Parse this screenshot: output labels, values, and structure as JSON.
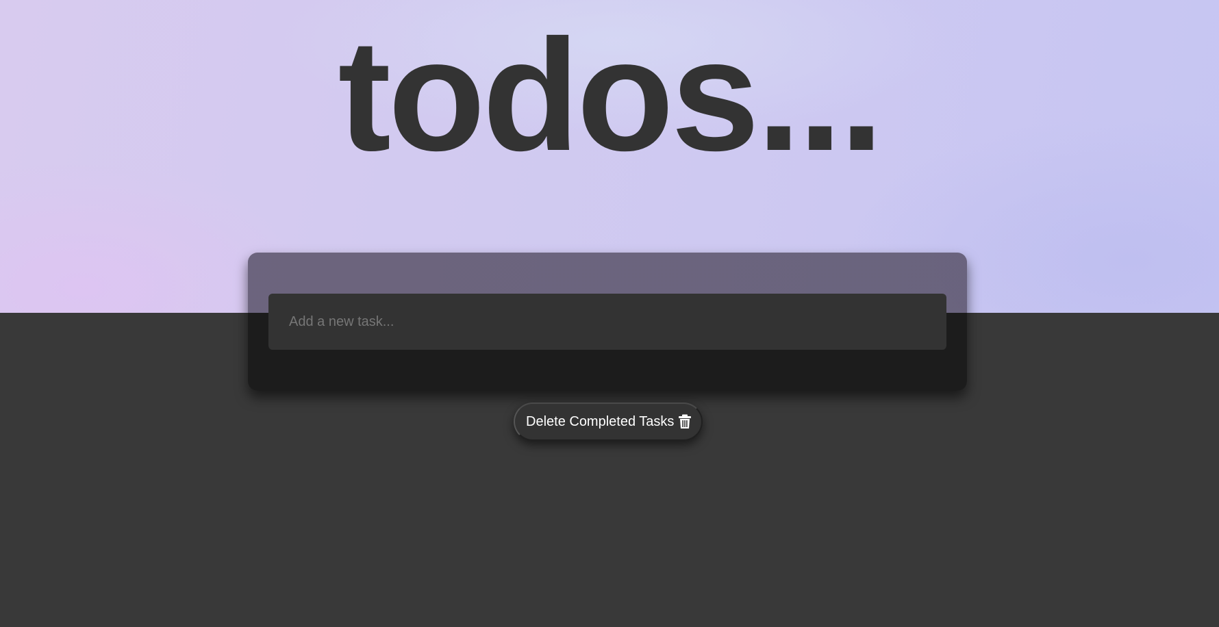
{
  "header": {
    "title": "todos..."
  },
  "new_task": {
    "placeholder": "Add a new task...",
    "value": ""
  },
  "actions": {
    "delete_completed_label": "Delete Completed Tasks",
    "delete_completed_icon": "trash-icon"
  },
  "colors": {
    "title": "#333333",
    "background": "#393939",
    "card": "#1c1c1c",
    "input": "#333333"
  }
}
